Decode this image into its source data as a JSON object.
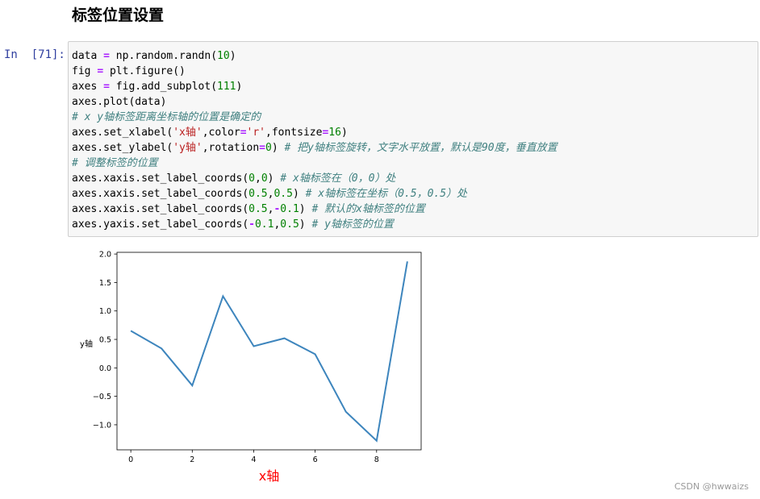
{
  "heading": "标签位置设置",
  "cell": {
    "prompt": "In  [71]:",
    "lines": [
      [
        {
          "t": "data "
        },
        {
          "t": "=",
          "c": "op"
        },
        {
          "t": " np.random.randn("
        },
        {
          "t": "10",
          "c": "num"
        },
        {
          "t": ")"
        }
      ],
      [
        {
          "t": "fig "
        },
        {
          "t": "=",
          "c": "op"
        },
        {
          "t": " plt.figure()"
        }
      ],
      [
        {
          "t": "axes "
        },
        {
          "t": "=",
          "c": "op"
        },
        {
          "t": " fig.add_subplot("
        },
        {
          "t": "111",
          "c": "num"
        },
        {
          "t": ")"
        }
      ],
      [
        {
          "t": "axes.plot(data)"
        }
      ],
      [
        {
          "t": "# x y轴标签距离坐标轴的位置是确定的",
          "c": "com"
        }
      ],
      [
        {
          "t": "axes.set_xlabel("
        },
        {
          "t": "'x轴'",
          "c": "str"
        },
        {
          "t": ",color"
        },
        {
          "t": "=",
          "c": "op"
        },
        {
          "t": "'r'",
          "c": "str"
        },
        {
          "t": ",fontsize"
        },
        {
          "t": "=",
          "c": "op"
        },
        {
          "t": "16",
          "c": "num"
        },
        {
          "t": ")"
        }
      ],
      [
        {
          "t": "axes.set_ylabel("
        },
        {
          "t": "'y轴'",
          "c": "str"
        },
        {
          "t": ",rotation"
        },
        {
          "t": "=",
          "c": "op"
        },
        {
          "t": "0",
          "c": "num"
        },
        {
          "t": ") "
        },
        {
          "t": "# 把y轴标签旋转，文字水平放置，默认是90度，垂直放置",
          "c": "com"
        }
      ],
      [
        {
          "t": "# 调整标签的位置",
          "c": "com"
        }
      ],
      [
        {
          "t": "axes.xaxis.set_label_coords("
        },
        {
          "t": "0",
          "c": "num"
        },
        {
          "t": ","
        },
        {
          "t": "0",
          "c": "num"
        },
        {
          "t": ") "
        },
        {
          "t": "# x轴标签在（0，0）处",
          "c": "com"
        }
      ],
      [
        {
          "t": "axes.xaxis.set_label_coords("
        },
        {
          "t": "0.5",
          "c": "num"
        },
        {
          "t": ","
        },
        {
          "t": "0.5",
          "c": "num"
        },
        {
          "t": ") "
        },
        {
          "t": "# x轴标签在坐标（0.5，0.5）处",
          "c": "com"
        }
      ],
      [
        {
          "t": "axes.xaxis.set_label_coords("
        },
        {
          "t": "0.5",
          "c": "num"
        },
        {
          "t": ","
        },
        {
          "t": "-",
          "c": "op"
        },
        {
          "t": "0.1",
          "c": "num"
        },
        {
          "t": ") "
        },
        {
          "t": "# 默认的x轴标签的位置",
          "c": "com"
        }
      ],
      [
        {
          "t": "axes.yaxis.set_label_coords("
        },
        {
          "t": "-",
          "c": "op"
        },
        {
          "t": "0.1",
          "c": "num"
        },
        {
          "t": ","
        },
        {
          "t": "0.5",
          "c": "num"
        },
        {
          "t": ") "
        },
        {
          "t": "# y轴标签的位置",
          "c": "com"
        }
      ]
    ]
  },
  "chart_data": {
    "type": "line",
    "x": [
      0,
      1,
      2,
      3,
      4,
      5,
      6,
      7,
      8,
      9
    ],
    "series": [
      {
        "values": [
          0.65,
          0.34,
          -0.31,
          1.26,
          0.38,
          0.52,
          0.24,
          -0.77,
          -1.28,
          1.87
        ]
      }
    ],
    "xlabel": "x轴",
    "ylabel": "y轴",
    "xlim": [
      -0.45,
      9.45
    ],
    "ylim": [
      -1.44,
      2.03
    ],
    "xticks": [
      0,
      2,
      4,
      6,
      8
    ],
    "yticks": [
      -1.0,
      -0.5,
      0.0,
      0.5,
      1.0,
      1.5,
      2.0
    ],
    "xtick_labels": [
      "0",
      "2",
      "4",
      "6",
      "8"
    ],
    "ytick_labels": [
      "−1.0",
      "−0.5",
      "0.0",
      "0.5",
      "1.0",
      "1.5",
      "2.0"
    ],
    "grid": false,
    "line_color": "#3d85bd",
    "xlabel_color": "#ff0000"
  },
  "watermark": "CSDN @hwwaizs",
  "colors": {
    "prompt": "#303f9f",
    "cell_bg": "#f7f7f7",
    "cell_border": "#cfcfcf"
  }
}
